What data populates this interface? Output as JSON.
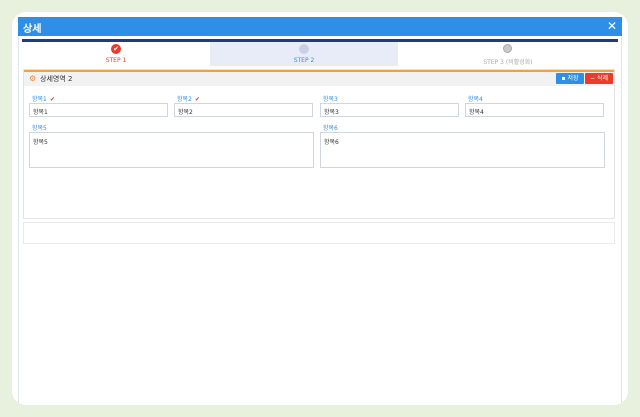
{
  "dialog": {
    "title": "상세",
    "close_symbol": "✕"
  },
  "steps": [
    {
      "label": "STEP 1",
      "status": "completed",
      "check": "✔"
    },
    {
      "label": "STEP 2",
      "status": "current"
    },
    {
      "label": "STEP 3 (비활성화)",
      "status": "disabled"
    }
  ],
  "section": {
    "title": "상세영역 2",
    "save_label": "저장",
    "delete_label": "삭제"
  },
  "fields": {
    "f1": {
      "label": "항목1",
      "value": "항목1",
      "check": "✔"
    },
    "f2": {
      "label": "항목2",
      "value": "항목2",
      "check": "✔"
    },
    "f3": {
      "label": "항목3",
      "value": "항목3"
    },
    "f4": {
      "label": "항목4",
      "value": "항목4"
    },
    "f5": {
      "label": "항목5",
      "value": "항목5"
    },
    "f6": {
      "label": "항목6",
      "value": "항목6"
    }
  },
  "colors": {
    "titlebar": "#2f8fe6",
    "accent_blue": "#2f8fe6",
    "accent_red": "#ea3b2c",
    "section_accent": "#f0a13a"
  },
  "icons": {
    "close": "close-icon",
    "step_done": "check-icon",
    "section": "gear-icon",
    "save": "save-icon",
    "delete": "delete-icon"
  }
}
